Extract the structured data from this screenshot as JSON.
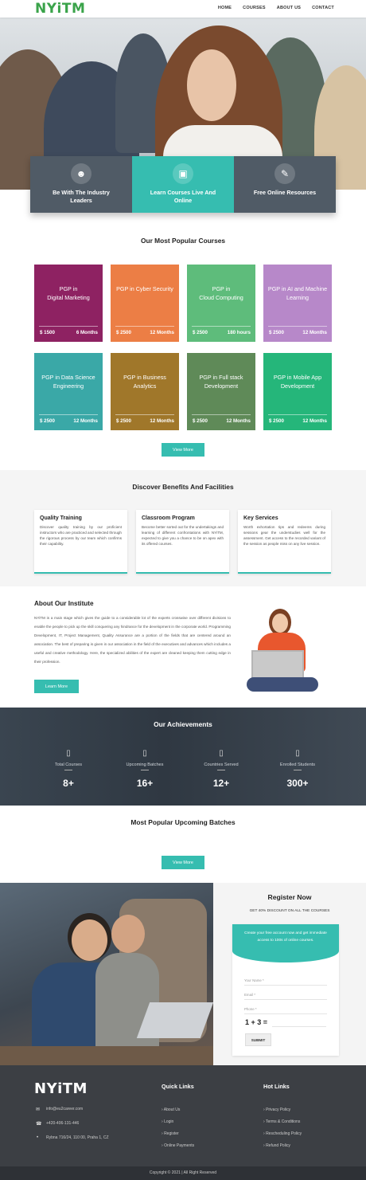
{
  "header": {
    "logo": "NYiTM",
    "nav": [
      "HOME",
      "COURSES",
      "ABOUT US",
      "CONTACT"
    ]
  },
  "hero": {
    "boxes": [
      {
        "label": "Be With The Industry Leaders",
        "icon": "people-icon"
      },
      {
        "label": "Learn Courses Live And Online",
        "icon": "monitor-icon"
      },
      {
        "label": "Free Online Resources",
        "icon": "resources-icon"
      }
    ]
  },
  "courses": {
    "title": "Our Most Popular Courses",
    "button": "View More",
    "items": [
      {
        "name": "PGP in\nDigital Marketing",
        "price": "$ 1500",
        "duration": "6 Months",
        "color": "#8e2262"
      },
      {
        "name": "PGP in Cyber Security",
        "price": "$ 2500",
        "duration": "12 Months",
        "color": "#ec7e45"
      },
      {
        "name": "PGP in\nCloud Computing",
        "price": "$ 2500",
        "duration": "180 hours",
        "color": "#5ebc7b"
      },
      {
        "name": "PGP in AI and Machine Learning",
        "price": "$ 2500",
        "duration": "12 Months",
        "color": "#b788c9"
      },
      {
        "name": "PGP in Data Science Engineering",
        "price": "$ 2500",
        "duration": "12 Months",
        "color": "#3aa8a7"
      },
      {
        "name": "PGP in Business Analytics",
        "price": "$ 2500",
        "duration": "12 Months",
        "color": "#a0772a"
      },
      {
        "name": "PGP in Full stack Development",
        "price": "$ 2500",
        "duration": "12 Months",
        "color": "#5f8a58"
      },
      {
        "name": "PGP in Mobile App Development",
        "price": "$ 2500",
        "duration": "12 Months",
        "color": "#25b67a"
      }
    ]
  },
  "benefits": {
    "title": "Discover Benefits And Facilities",
    "items": [
      {
        "title": "Quality Training",
        "text": "Discover quality training by our proficient instructors who are practiced and selected through the rigorous process by our team which confirms their capability."
      },
      {
        "title": "Classroom Program",
        "text": "Become better sorted out for the undertakings and learning of different confrontations with NYiTM, expected to give you a chance to be on apex with its offered courses."
      },
      {
        "title": "Key Services",
        "text": "Worth exhortation tips and redeems during sessions gear the understudies well for the assessment. Get access to the recorded variant of the session as people miss on any live session."
      }
    ]
  },
  "about": {
    "title": "About Our Institute",
    "text": "NYiTM is a main stage which gives the guide to a considerable lot of the experts crosswise over different divisions to enable the people to pick up the skill conquering any hindrance for the development in the corporate world. Programming Development, IT, Project Management, Quality Assurance are a portion of the fields that are centered around an association. The best of preparing is given in our association in the field of the executives and advances which includes a useful and creative methodology. Here, the specialized abilities of the expert are cleaned keeping them cutting edge in their profession.",
    "button": "Learn More"
  },
  "achievements": {
    "title": "Our Achievements",
    "items": [
      {
        "label": "Total Courses",
        "value": "8+"
      },
      {
        "label": "Upcoming Batches",
        "value": "16+"
      },
      {
        "label": "Countries Served",
        "value": "12+"
      },
      {
        "label": "Enrolled Students",
        "value": "300+"
      }
    ]
  },
  "batches": {
    "title": "Most Popular Upcoming Batches",
    "button": "View More"
  },
  "register": {
    "title": "Register Now",
    "subtitle": "GET 40% DISCOUNT ON ALL THE COURSES",
    "card_text": "Create your free account now and get immediate access to 100s of online courses.",
    "fields": [
      "Your Name *",
      "Email *",
      "Phone *"
    ],
    "captcha": "1 + 3 =",
    "submit": "SUBMIT"
  },
  "footer": {
    "logo": "NYiTM",
    "email": "info@eu2career.com",
    "phone": "+420-406-131-446",
    "address": "Rybna 716/24, 110 00, Praha 1, CZ",
    "quick_title": "Quick Links",
    "quick": [
      "About Us",
      "Login",
      "Register",
      "Online Payments"
    ],
    "hot_title": "Hot Links",
    "hot": [
      "Privacy Policy",
      "Terms & Conditions",
      "Rescheduling Policy",
      "Refund Policy"
    ],
    "copyright": "Copyright © 2021 | All Right Reserved"
  },
  "colors": {
    "accent": "#36bdb0",
    "logo": "#3aa34a",
    "dark": "#505b66"
  }
}
